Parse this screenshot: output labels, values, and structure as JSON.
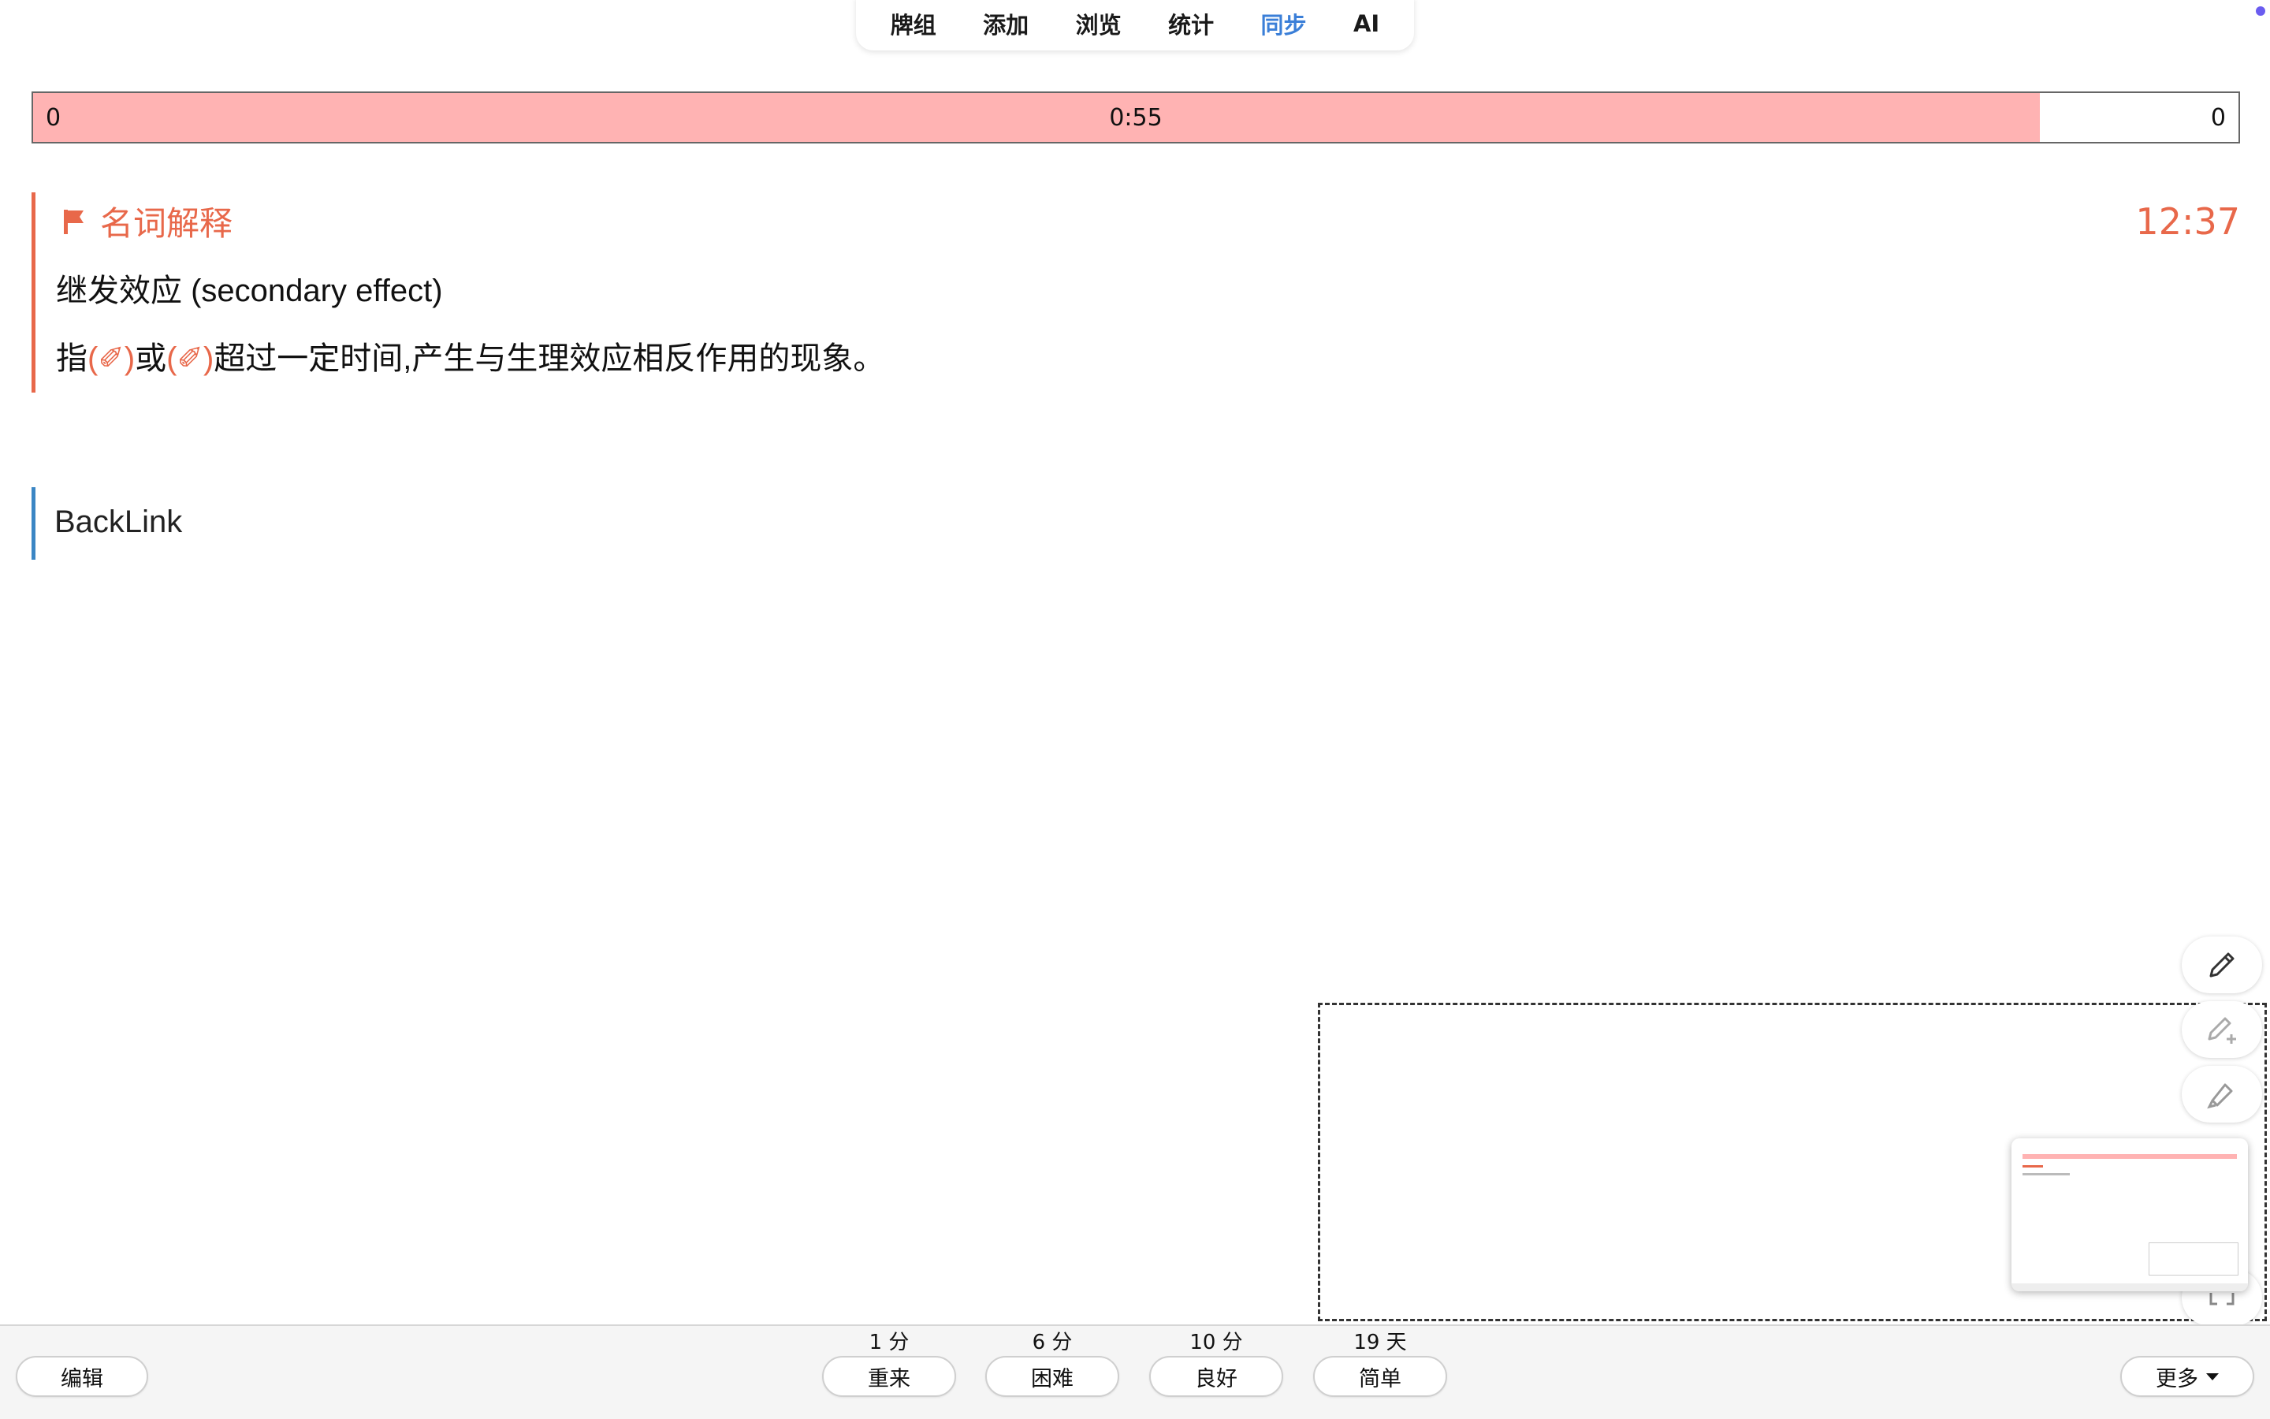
{
  "nav": {
    "tabs": [
      "牌组",
      "添加",
      "浏览",
      "统计",
      "同步",
      "AI"
    ],
    "active": "同步"
  },
  "progress": {
    "left": "0",
    "center": "0:55",
    "right": "0",
    "fraction_elapsed": 0.91
  },
  "card": {
    "type": "名词解释",
    "time": "12:37",
    "term": "继发效应 (secondary effect)",
    "def_prefix": "指",
    "cloze1": "(✐)",
    "def_mid": "或",
    "cloze2": "(✐)",
    "def_suffix": "超过一定时间,产生与生理效应相反作用的现象。"
  },
  "backlink": "BackLink",
  "answers": [
    {
      "interval": "1 分",
      "label": "重来"
    },
    {
      "interval": "6 分",
      "label": "困难"
    },
    {
      "interval": "10 分",
      "label": "良好"
    },
    {
      "interval": "19 天",
      "label": "简单"
    }
  ],
  "edit_label": "编辑",
  "more_label": "更多",
  "colors": {
    "accent": "#e8684a",
    "progress_fill": "#ffb3b3",
    "active_tab": "#3b7fd8",
    "backlink_bar": "#3b86c4"
  },
  "icons": [
    "flag-icon",
    "pencil-icon",
    "pencil-plus-icon",
    "highlighter-icon",
    "caret-down-icon"
  ]
}
